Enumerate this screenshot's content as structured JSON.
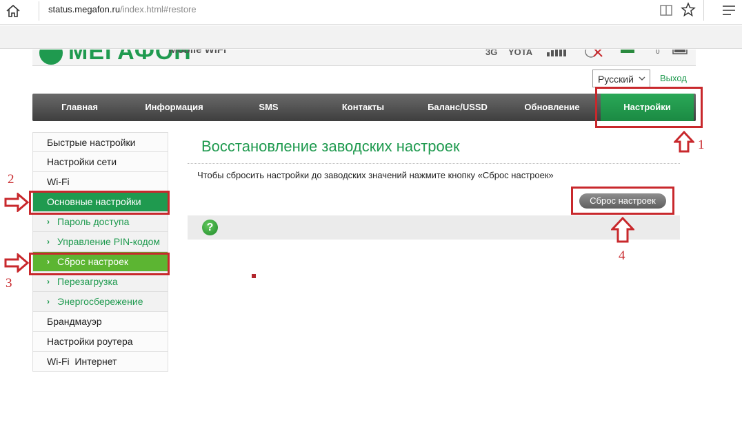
{
  "browser": {
    "url_host": "status.megafon.ru",
    "url_path": "/index.html#restore"
  },
  "header": {
    "logo_text": "МЕГАФОН",
    "logo_sub": "Mobile WiFi",
    "status_network": "3G",
    "status_operator": "YOTA",
    "status_sms_count": "0"
  },
  "language": {
    "selected": "Русский"
  },
  "logout_label": "Выход",
  "nav": {
    "items": [
      {
        "label": "Главная"
      },
      {
        "label": "Информация"
      },
      {
        "label": "SMS"
      },
      {
        "label": "Контакты"
      },
      {
        "label": "Баланс/USSD"
      },
      {
        "label": "Обновление"
      },
      {
        "label": "Настройки"
      }
    ],
    "active_index": 6
  },
  "sidebar": {
    "items": [
      {
        "label": "Быстрые настройки"
      },
      {
        "label": "Настройки сети"
      },
      {
        "label": "Wi-Fi"
      },
      {
        "label": "Основные настройки"
      },
      {
        "label": "Пароль доступа"
      },
      {
        "label": "Управление PIN-кодом"
      },
      {
        "label": "Сброс настроек"
      },
      {
        "label": "Перезагрузка"
      },
      {
        "label": "Энергосбережение"
      },
      {
        "label": "Брандмауэр"
      },
      {
        "label": "Настройки роутера"
      },
      {
        "label": "Wi-Fi  Интернет"
      }
    ]
  },
  "main": {
    "title": "Восстановление заводских настроек",
    "description": "Чтобы сбросить настройки до заводских значений нажмите кнопку «Сброс настроек»",
    "reset_button": "Сброс настроек",
    "help_symbol": "?"
  },
  "annotations": {
    "step1": "1",
    "step2": "2",
    "step3": "3",
    "step4": "4"
  },
  "colors": {
    "brand_green": "#1f9a4f",
    "current_green": "#5cb532",
    "annotation_red": "#c8282c"
  }
}
